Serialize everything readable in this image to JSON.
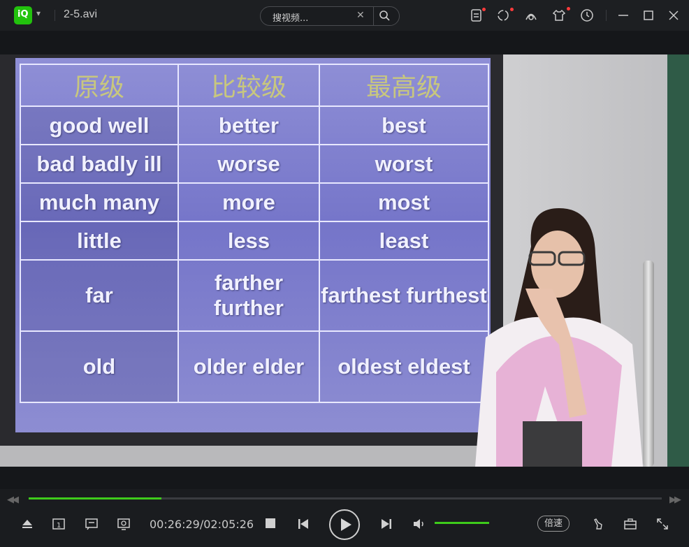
{
  "titlebar": {
    "filename": "2-5.avi",
    "search_placeholder": "搜视频..."
  },
  "slide": {
    "headers": [
      "原级",
      "比较级",
      "最高级"
    ],
    "rows": [
      [
        "good well",
        "better",
        "best"
      ],
      [
        "bad badly ill",
        "worse",
        "worst"
      ],
      [
        "much many",
        "more",
        "most"
      ],
      [
        "little",
        "less",
        "least"
      ],
      [
        "far",
        "farther further",
        "farthest furthest"
      ],
      [
        "old",
        "older elder",
        "oldest eldest"
      ]
    ]
  },
  "player": {
    "time": "00:26:29/02:05:26",
    "progress_percent": 21,
    "volume_percent": 100,
    "speed_label": "倍速"
  },
  "colors": {
    "accent": "#3ecb1b",
    "logo": "#22c20d",
    "badge": "#ff3b3b"
  }
}
